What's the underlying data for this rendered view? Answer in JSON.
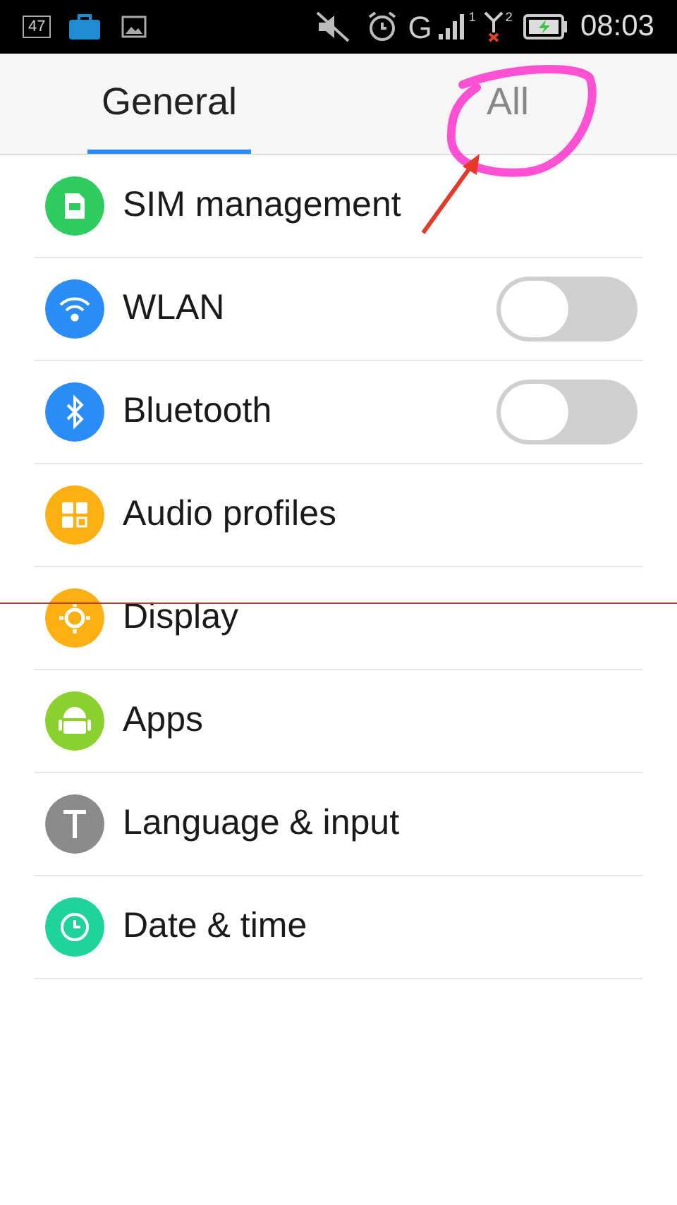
{
  "status_bar": {
    "notification_count": "47",
    "network_type": "G",
    "sim_1": "1",
    "sim_2": "2",
    "time": "08:03"
  },
  "tabs": [
    {
      "label": "General",
      "selected": true
    },
    {
      "label": "All",
      "selected": false
    }
  ],
  "settings": [
    {
      "label": "SIM management",
      "kind": "plain",
      "color": "#2ecc5f"
    },
    {
      "label": "WLAN",
      "kind": "toggle",
      "on": false,
      "color": "#2a8cf6"
    },
    {
      "label": "Bluetooth",
      "kind": "toggle",
      "on": false,
      "color": "#2a8cf6"
    },
    {
      "label": "Audio profiles",
      "kind": "plain",
      "color": "#fdb013"
    },
    {
      "label": "Display",
      "kind": "plain",
      "color": "#fdb013"
    },
    {
      "label": "Apps",
      "kind": "plain",
      "color": "#8ad12f"
    },
    {
      "label": "Language & input",
      "kind": "plain",
      "color": "#8a8a8a"
    },
    {
      "label": "Date & time",
      "kind": "plain",
      "color": "#1fd49a"
    }
  ]
}
